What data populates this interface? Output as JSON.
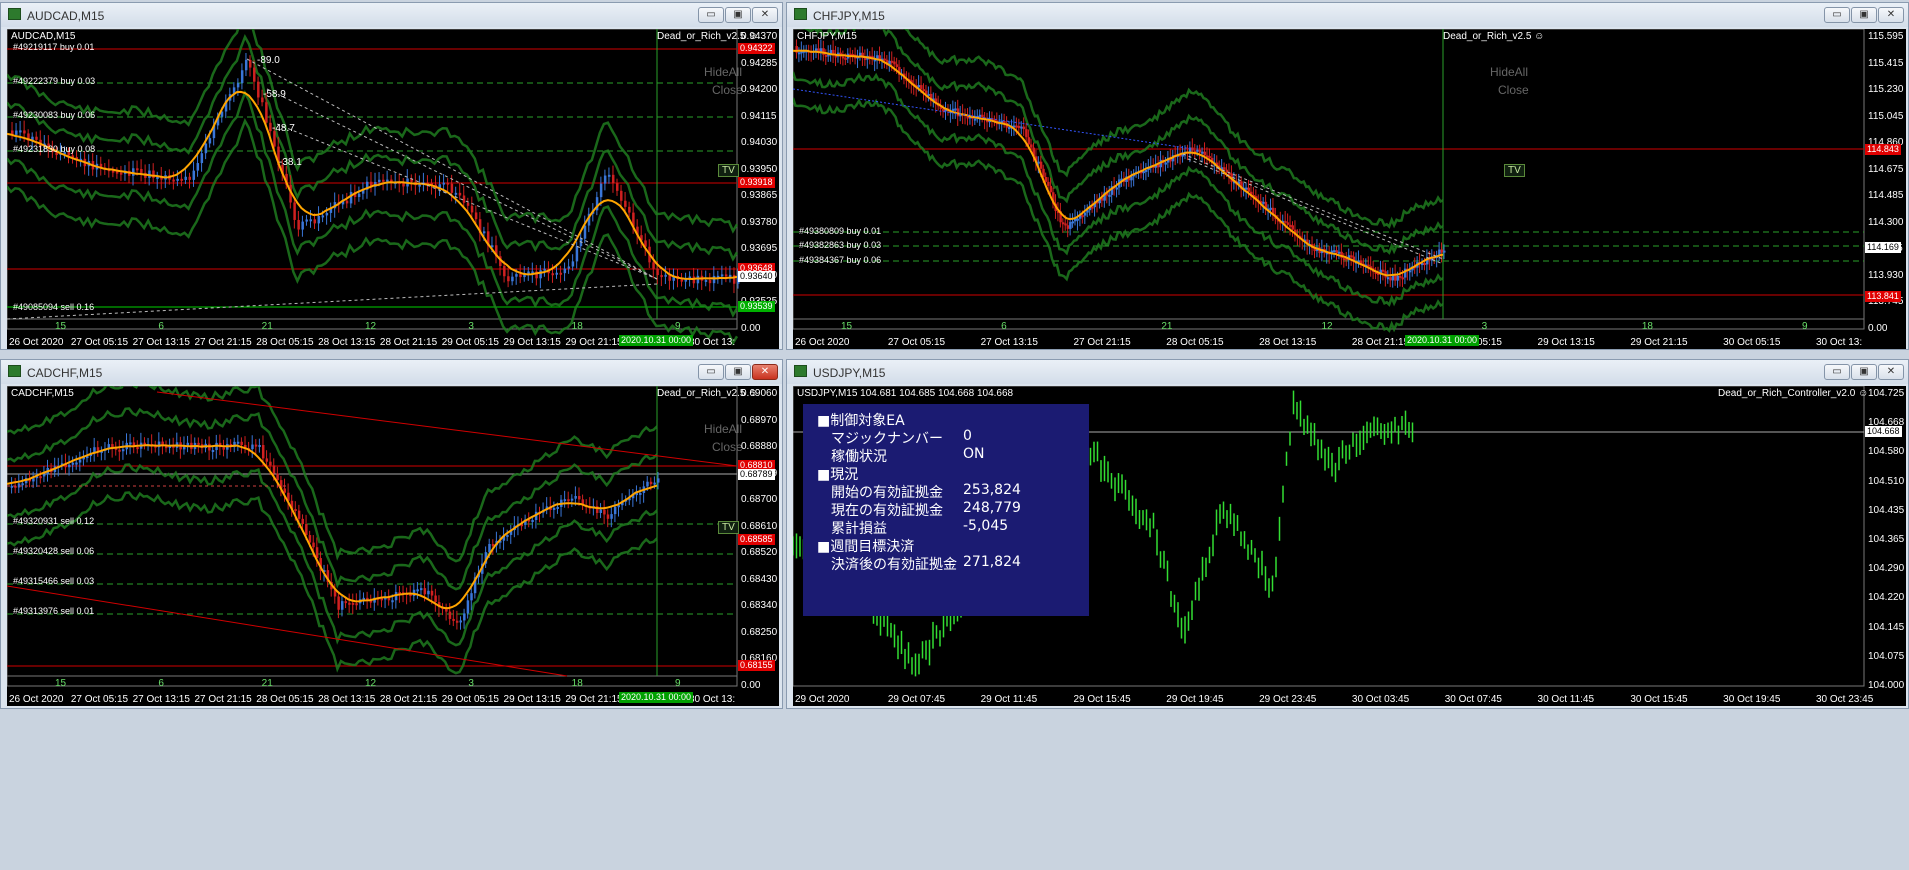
{
  "colors": {
    "bull": "#3a76d8",
    "bear": "#d02020",
    "ma": "#ffa500",
    "band": "#1a6a1a",
    "gridline": "#00c000"
  },
  "windows": [
    {
      "title": "AUDCAD,M15",
      "symbol": "AUDCAD,M15",
      "ea": "Dead_or_Rich_v2.5 ☺",
      "hideall": "HideAll",
      "close": "Close",
      "tv": "TV",
      "price_axis": [
        "0.94370",
        "0.94285",
        "0.94200",
        "0.94115",
        "0.94030",
        "0.93950",
        "0.93865",
        "0.93780",
        "0.93695",
        "0.93610",
        "0.93525",
        "0.00"
      ],
      "price_boxes": [
        {
          "text": "0.94322",
          "style": "red"
        },
        {
          "text": "0.93918",
          "style": "red"
        },
        {
          "text": "0.93648",
          "style": "red"
        },
        {
          "text": "0.93640",
          "style": "white"
        },
        {
          "text": "0.93539",
          "style": "green"
        }
      ],
      "orders": [
        "#49219117 buy 0.01",
        "#49222379 buy 0.03",
        "#49230083 buy 0.06",
        "#49231830 buy 0.08",
        "#49085094 sell 0.16"
      ],
      "pips": [
        "-89.0",
        "-58.9",
        "-48.7",
        "-38.1"
      ],
      "day_marks": [
        "15",
        "6",
        "21",
        "12",
        "3",
        "18",
        "9"
      ],
      "time_axis": [
        "26 Oct 2020",
        "27 Oct 05:15",
        "27 Oct 13:15",
        "27 Oct 21:15",
        "28 Oct 05:15",
        "28 Oct 13:15",
        "28 Oct 21:15",
        "29 Oct 05:15",
        "29 Oct 13:15",
        "29 Oct 21:15",
        "30 Oct 05:15",
        "30 Oct 13:"
      ],
      "date_box": "2020.10.31 00:00"
    },
    {
      "title": "CHFJPY,M15",
      "symbol": "CHFJPY,M15",
      "ea": "Dead_or_Rich_v2.5 ☺",
      "hideall": "HideAll",
      "close": "Close",
      "tv": "TV",
      "price_axis": [
        "115.595",
        "115.415",
        "115.230",
        "115.045",
        "114.860",
        "114.675",
        "114.485",
        "114.300",
        "114.115",
        "113.930",
        "113.745",
        "0.00"
      ],
      "price_boxes": [
        {
          "text": "114.843",
          "style": "red"
        },
        {
          "text": "114.169",
          "style": "white"
        },
        {
          "text": "113.841",
          "style": "red"
        }
      ],
      "orders": [
        "#49380809 buy 0.01",
        "#49382863 buy 0.03",
        "#49384367 buy 0.06"
      ],
      "day_marks": [
        "15",
        "6",
        "21",
        "12",
        "3",
        "18",
        "9"
      ],
      "time_axis": [
        "26 Oct 2020",
        "27 Oct 05:15",
        "27 Oct 13:15",
        "27 Oct 21:15",
        "28 Oct 05:15",
        "28 Oct 13:15",
        "28 Oct 21:15",
        "29 Oct 05:15",
        "29 Oct 13:15",
        "29 Oct 21:15",
        "30 Oct 05:15",
        "30 Oct 13:"
      ],
      "date_box": "2020.10.31 00:00"
    },
    {
      "title": "CADCHF,M15",
      "symbol": "CADCHF,M15",
      "ea": "Dead_or_Rich_v2.5 ☺",
      "hideall": "HideAll",
      "close": "Close",
      "tv": "TV",
      "price_axis": [
        "0.69060",
        "0.68970",
        "0.68880",
        "0.68789",
        "0.68700",
        "0.68610",
        "0.68520",
        "0.68430",
        "0.68340",
        "0.68250",
        "0.68160",
        "0.00"
      ],
      "price_boxes": [
        {
          "text": "0.68810",
          "style": "red"
        },
        {
          "text": "0.68789",
          "style": "white"
        },
        {
          "text": "0.68585",
          "style": "red"
        },
        {
          "text": "0.68155",
          "style": "red"
        }
      ],
      "orders": [
        "#49320931 sell 0.12",
        "#49320428 sell 0.06",
        "#49315466 sell 0.03",
        "#49313976 sell 0.01"
      ],
      "day_marks": [
        "15",
        "6",
        "21",
        "12",
        "3",
        "18",
        "9"
      ],
      "time_axis": [
        "26 Oct 2020",
        "27 Oct 05:15",
        "27 Oct 13:15",
        "27 Oct 21:15",
        "28 Oct 05:15",
        "28 Oct 13:15",
        "28 Oct 21:15",
        "29 Oct 05:15",
        "29 Oct 13:15",
        "29 Oct 21:15",
        "30 Oct 05:15",
        "30 Oct 13:"
      ],
      "date_box": "2020.10.31 00:00"
    },
    {
      "title": "USDJPY,M15",
      "symbol": "USDJPY,M15  104.681 104.685 104.668 104.668",
      "ea": "Dead_or_Rich_Controller_v2.0 ☺",
      "price_axis": [
        "104.725",
        "104.668",
        "104.580",
        "104.510",
        "104.435",
        "104.365",
        "104.290",
        "104.220",
        "104.145",
        "104.075",
        "104.000"
      ],
      "price_boxes": [
        {
          "text": "104.668",
          "style": "white"
        }
      ],
      "time_axis": [
        "29 Oct 2020",
        "29 Oct 07:45",
        "29 Oct 11:45",
        "29 Oct 15:45",
        "29 Oct 19:45",
        "29 Oct 23:45",
        "30 Oct 03:45",
        "30 Oct 07:45",
        "30 Oct 11:45",
        "30 Oct 15:45",
        "30 Oct 19:45",
        "30 Oct 23:45"
      ],
      "info_panel": [
        {
          "label": "■制御対象EA",
          "value": ""
        },
        {
          "label": "　マジックナンバー",
          "value": "0"
        },
        {
          "label": "　稼働状況",
          "value": "ON"
        },
        {
          "label": "■現況",
          "value": ""
        },
        {
          "label": "　開始の有効証拠金",
          "value": "253,824"
        },
        {
          "label": "　現在の有効証拠金",
          "value": "248,779"
        },
        {
          "label": "　累計損益",
          "value": "-5,045"
        },
        {
          "label": "■週間目標決済",
          "value": ""
        },
        {
          "label": "　決済後の有効証拠金",
          "value": "271,824"
        }
      ]
    }
  ]
}
